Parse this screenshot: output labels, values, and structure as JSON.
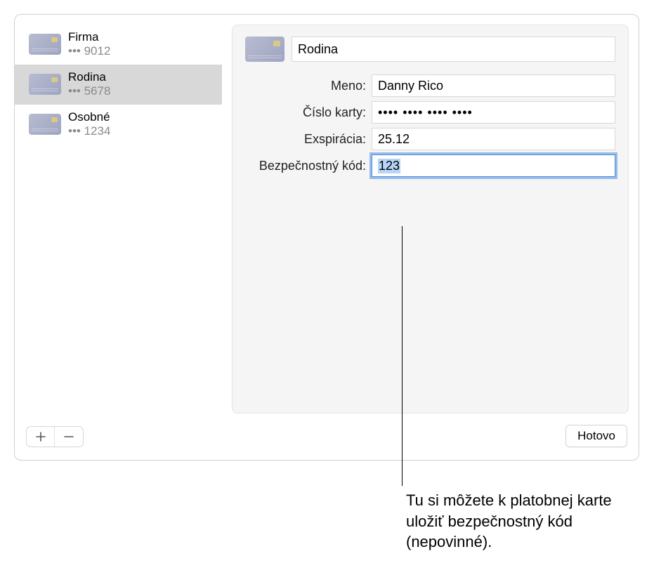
{
  "sidebar": {
    "items": [
      {
        "title": "Firma",
        "sub": "••• 9012"
      },
      {
        "title": "Rodina",
        "sub": "••• 5678"
      },
      {
        "title": "Osobné",
        "sub": "••• 1234"
      }
    ],
    "selected_index": 1
  },
  "main": {
    "description": "Rodina",
    "fields": {
      "name_label": "Meno:",
      "name_value": "Danny Rico",
      "number_label": "Číslo karty:",
      "number_value": "•••• •••• •••• ••••",
      "expiry_label": "Exspirácia:",
      "expiry_value": "25.12",
      "security_label": "Bezpečnostný kód:",
      "security_value": "123"
    }
  },
  "controls": {
    "add": "＋",
    "remove": "－",
    "done": "Hotovo"
  },
  "callout": {
    "text": "Tu si môžete k platobnej karte uložiť bezpečnostný kód (nepovinné)."
  }
}
